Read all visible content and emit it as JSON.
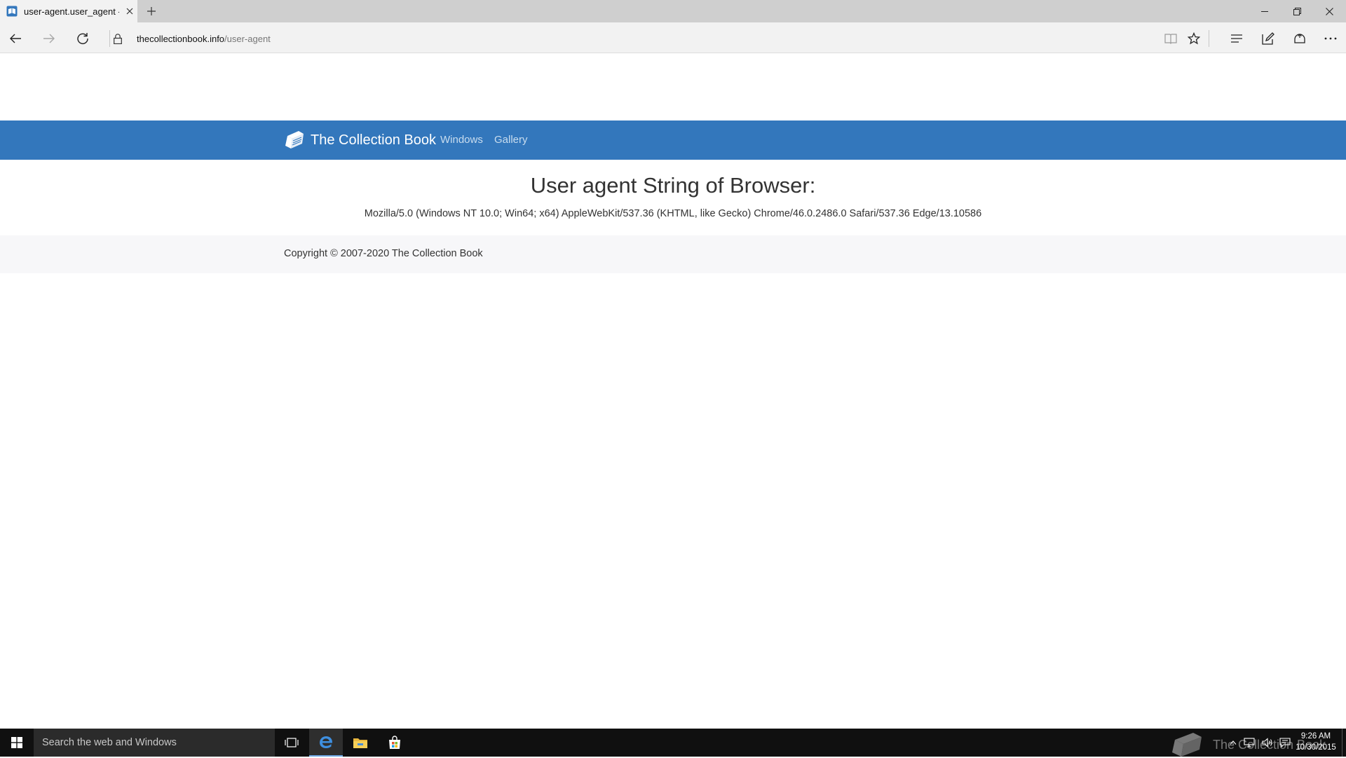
{
  "browser": {
    "tab": {
      "title": "user-agent.user_agent -",
      "favicon": "book-favicon-icon"
    },
    "new_tab_icon": "plus-icon",
    "window_controls": [
      "minimize-icon",
      "restore-icon",
      "close-icon"
    ],
    "address": {
      "domain": "thecollectionbook.info",
      "path": "/user-agent"
    },
    "toolbar_icons": [
      "reading-view-icon",
      "favorites-star-icon",
      "hub-icon",
      "web-note-icon",
      "share-icon",
      "more-icon"
    ]
  },
  "site": {
    "brand": "The Collection Book",
    "nav_links": [
      "Windows",
      "Gallery"
    ],
    "colors": {
      "navbar": "#3377bc",
      "nav_link": "#c9ddef"
    }
  },
  "main": {
    "heading": "User agent String of Browser:",
    "user_agent": "Mozilla/5.0 (Windows NT 10.0; Win64; x64) AppleWebKit/537.36 (KHTML, like Gecko) Chrome/46.0.2486.0 Safari/537.36 Edge/13.10586"
  },
  "footer": {
    "copyright": "Copyright © 2007-2020 The Collection Book"
  },
  "taskbar": {
    "search_placeholder": "Search the web and Windows",
    "pinned": [
      "task-view-icon",
      "edge-icon",
      "file-explorer-icon",
      "store-icon"
    ],
    "watermark": "The Collection Book",
    "clock": {
      "time": "9:26 AM",
      "date": "10/30/2015"
    }
  }
}
